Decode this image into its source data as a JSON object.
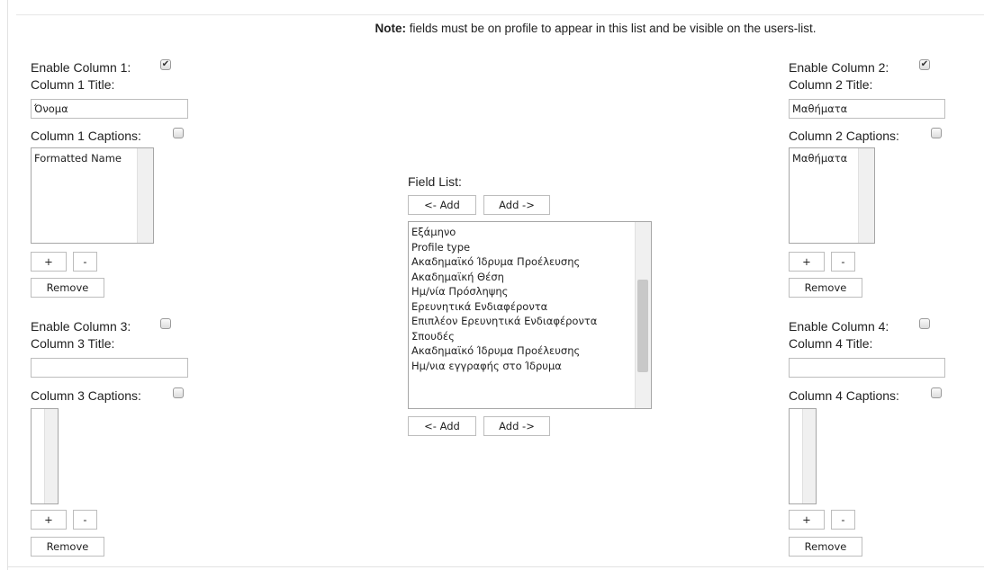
{
  "note": {
    "bold": "Note:",
    "text": " fields must be on profile to appear in this list and be visible on the users-list."
  },
  "columns": [
    {
      "enable_label": "Enable Column 1:",
      "enabled": true,
      "title_label": "Column 1 Title:",
      "title_value": "Όνομα",
      "captions_label": "Column 1 Captions:",
      "captions_checked": false,
      "items": [
        "Formatted Name"
      ],
      "plus": "+",
      "minus": "-",
      "remove": "Remove"
    },
    {
      "enable_label": "Enable Column 2:",
      "enabled": true,
      "title_label": "Column 2 Title:",
      "title_value": "Μαθήματα",
      "captions_label": "Column 2 Captions:",
      "captions_checked": false,
      "items": [
        "Μαθήματα"
      ],
      "plus": "+",
      "minus": "-",
      "remove": "Remove"
    },
    {
      "enable_label": "Enable Column 3:",
      "enabled": false,
      "title_label": "Column 3 Title:",
      "title_value": "",
      "captions_label": "Column 3 Captions:",
      "captions_checked": false,
      "items": [],
      "plus": "+",
      "minus": "-",
      "remove": "Remove"
    },
    {
      "enable_label": "Enable Column 4:",
      "enabled": false,
      "title_label": "Column 4 Title:",
      "title_value": "",
      "captions_label": "Column 4 Captions:",
      "captions_checked": false,
      "items": [],
      "plus": "+",
      "minus": "-",
      "remove": "Remove"
    }
  ],
  "field_list": {
    "label": "Field List:",
    "add_left": "<- Add",
    "add_right": "Add ->",
    "items": [
      "Εξάμηνο",
      "Profile type",
      "Ακαδημαϊκό Ίδρυμα Προέλευσης",
      "Ακαδημαϊκή Θέση",
      "Ημ/νία Πρόσληψης",
      "Ερευνητικά Ενδιαφέροντα",
      "Επιπλέον Ερευνητικά Ενδιαφέροντα",
      "Σπουδές",
      "Ακαδημαϊκό Ίδρυμα Προέλευσης",
      "Ημ/νια εγγραφής στο Ίδρυμα"
    ],
    "scroll_position": 0.62
  }
}
